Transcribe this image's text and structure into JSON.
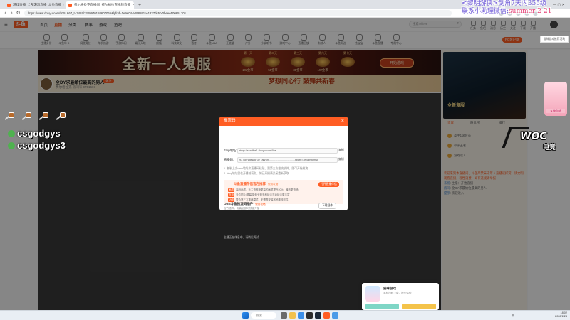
{
  "browser": {
    "tabs": [
      {
        "label": "游戏直播_全部游戏直播_斗鱼直播"
      },
      {
        "label": "费尔格拉克直播间_费尔格拉克视频直播"
      }
    ],
    "url": "https://www.douyu.com/9751667_t=3407/3329970158607066&lyfrid=1e9e04-a2985911e1227dc5b/0beee500651701"
  },
  "site": {
    "logo": "斗鱼",
    "nav": [
      "首页",
      "直播",
      "分类",
      "赛事",
      "游戏",
      "鱼吧"
    ],
    "search_placeholder": "搜索relieve",
    "right_icons": [
      "任务",
      "鱼吧",
      "消息",
      "历史",
      "关注",
      "下载",
      "开播"
    ],
    "categories": [
      "主播身份",
      "斗鱼年卡",
      "网游竞技",
      "单机热游",
      "手游休闲",
      "娱乐天地",
      "颜值",
      "科技文化",
      "语言",
      "斗鱼NBA",
      "正能量",
      "户外",
      "小说听书",
      "游戏中心",
      "直播回放",
      "有钱人",
      "斗鱼周边",
      "鱼宝宝",
      "斗鱼直播",
      "专属中心"
    ],
    "pc_button": "PC客户端"
  },
  "banner": {
    "title": "全新一人鬼服",
    "days": [
      {
        "label": "第一天",
        "reward": "2W金币"
      },
      {
        "label": "第二天",
        "reward": "50金币"
      },
      {
        "label": "第三天",
        "reward": "30金币"
      },
      {
        "label": "第六天",
        "reward": "1W金币"
      },
      {
        "label": "第七天",
        "reward": ""
      }
    ],
    "button": "开始游戏"
  },
  "room": {
    "title": "全DY求最给位最高的男人",
    "tag": "关注",
    "id_line": "费尔格拉克  房间号 9751667",
    "deco": "梦想同心行  鼓舞共新春"
  },
  "modal": {
    "title": "推流码",
    "rtmp_label": "rtmp地址:",
    "rtmp_value": "rtmp://sendfre1.douyu.com/live",
    "key_label": "直播码:",
    "key_value": "9375b/1gswkF3Y7ag/6h...................................xpath=3fs6bhtomsg",
    "copy_label": "复制",
    "notes": [
      "1. 复制上方rtmp地址和直播码粘贴，到第三方推流软件，即可开始推流",
      "2. rtmp地址需在开播前获取，如已开播请关闭重新获取"
    ],
    "upgrade_title": "斗鱼直播伴侣官方推荐",
    "upgrade_tag": "使用攻略",
    "upgrade_button": "打开直播伴侣",
    "features": [
      {
        "tag": "画质",
        "text": "高码画质，比主流推荐更高的画质提升20%，播放更流畅"
      },
      {
        "tag": "互动",
        "text": "多位图片/屏幕/摄像头等多种玩法互动玩法更丰富"
      },
      {
        "tag": "功能",
        "text": "整合第三方推荐模式，无需再安装其他推流软件"
      }
    ],
    "obs_title": "OBS斗鱼推流码插件",
    "obs_tag": "使用攻略",
    "obs_desc": "官方插件，安装后即可快速开播",
    "obs_button": "下载插件"
  },
  "player_hint": "主播正在休息中，请稍后再试",
  "right": {
    "promo": "全新鬼服",
    "tabs": [
      "贵宾",
      "粉丝团",
      "排行"
    ],
    "rank": [
      "高手1级会员",
      "小宇王者",
      "游戏达人"
    ],
    "chat_system": "欢迎来到本直播间，斗鱼严禁未成年人直播或打赏，请文明观看直播，理性消费，如有违规请举报",
    "chat": [
      {
        "user": "系统",
        "text": "主播：开始直播"
      },
      {
        "user": "房间",
        "text": "全DY求最给位最高的男人"
      },
      {
        "user": "提示",
        "text": "欢迎进入"
      }
    ],
    "side_btn": "猫咪游戏推荐活动"
  },
  "overlay": {
    "ad_line1": "<黎明游侠>剑角7天内355级",
    "ad_line2_prefix": "联系小助理微信:",
    "ad_line2_value": "summer-2-21",
    "players": [
      "csgodgys",
      "csgodgys3"
    ],
    "logo_main": "WOC",
    "logo_sub": "电竞",
    "side_img_text": "女神你好"
  },
  "popup": {
    "title": "猫咪游戏",
    "sub": "手机扫码下载，抢先体验"
  },
  "taskbar": {
    "search": "搜索",
    "lang": "中",
    "time": "18:02",
    "date": "2026/2/24"
  }
}
